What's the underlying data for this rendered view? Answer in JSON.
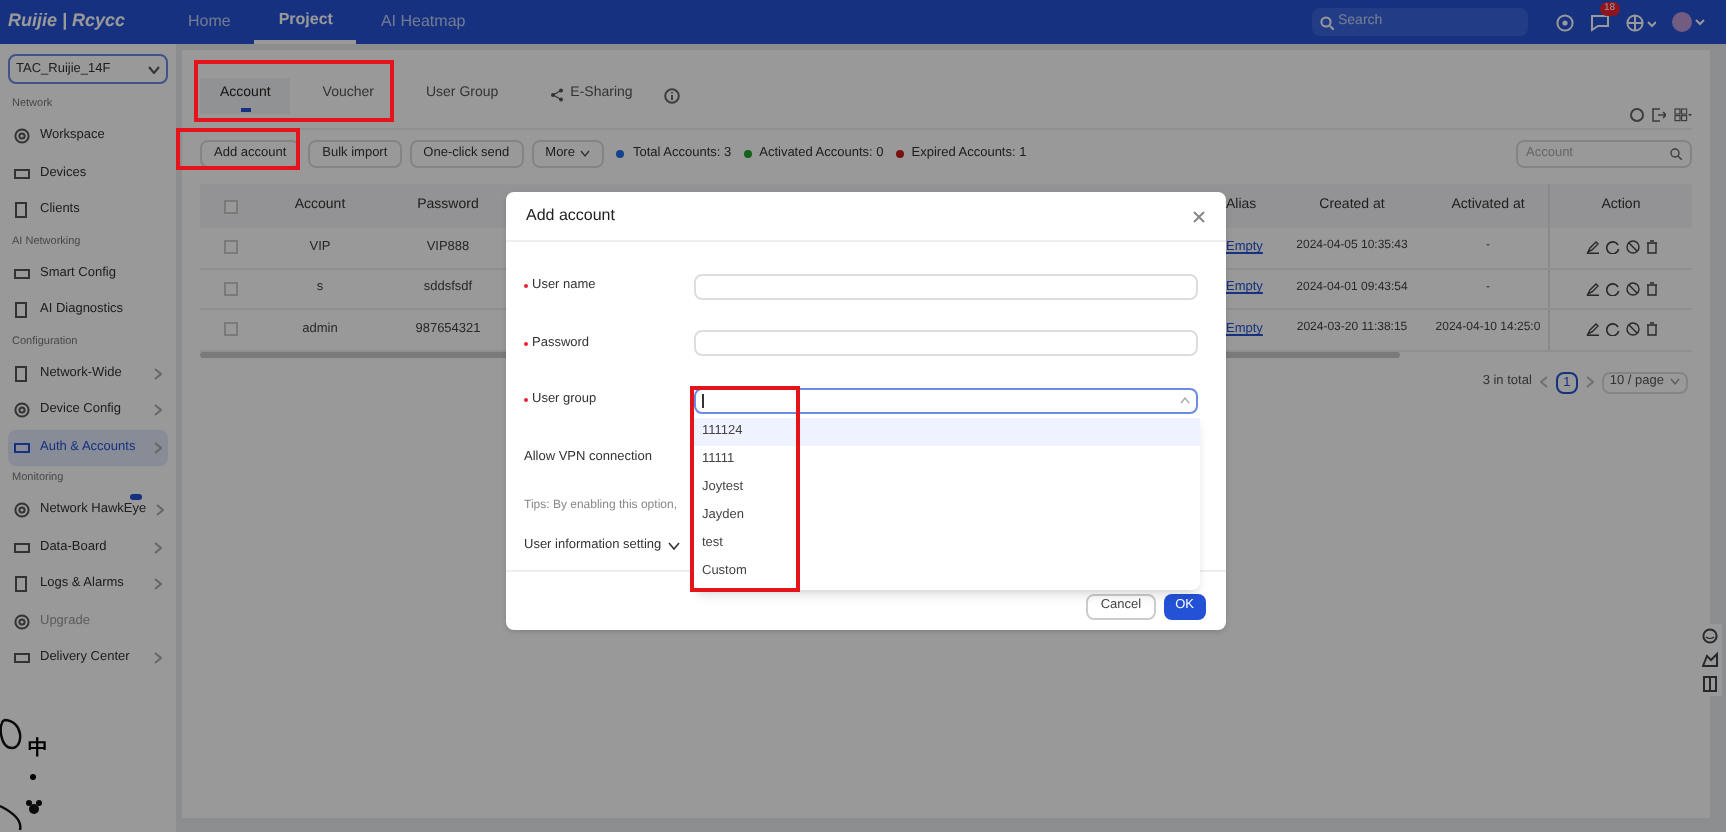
{
  "header": {
    "logo": "Ruijie | Rcycc",
    "nav": [
      {
        "label": "Home",
        "selected": false
      },
      {
        "label": "Project",
        "selected": true
      },
      {
        "label": "AI Heatmap",
        "selected": false
      }
    ],
    "search": {
      "placeholder": "Search"
    },
    "notification_count": "18"
  },
  "sidebar": {
    "project": "TAC_Ruijie_14F",
    "sections": [
      {
        "title": "Network",
        "items": [
          {
            "label": "Workspace",
            "selected": false,
            "submenu": false
          },
          {
            "label": "Devices",
            "selected": false,
            "submenu": false
          },
          {
            "label": "Clients",
            "selected": false,
            "submenu": false
          }
        ]
      },
      {
        "title": "AI Networking",
        "items": [
          {
            "label": "Smart Config",
            "selected": false,
            "submenu": false
          },
          {
            "label": "AI Diagnostics",
            "selected": false,
            "submenu": false
          }
        ]
      },
      {
        "title": "Configuration",
        "items": [
          {
            "label": "Network-Wide",
            "selected": false,
            "submenu": true
          },
          {
            "label": "Device Config",
            "selected": false,
            "submenu": true
          },
          {
            "label": "Auth & Accounts",
            "selected": true,
            "submenu": true
          }
        ]
      },
      {
        "title": "Monitoring",
        "items": [
          {
            "label": "Network HawkEye",
            "selected": false,
            "submenu": true,
            "new": true
          },
          {
            "label": "Data-Board",
            "selected": false,
            "submenu": true
          },
          {
            "label": "Logs & Alarms",
            "selected": false,
            "submenu": true
          },
          {
            "label": "Upgrade",
            "selected": false,
            "submenu": false,
            "disabled": true
          },
          {
            "label": "Delivery Center",
            "selected": false,
            "submenu": true
          }
        ]
      }
    ]
  },
  "ime_toolbar": {
    "mode": "中"
  },
  "tabs": [
    {
      "label": "Account",
      "selected": true
    },
    {
      "label": "Voucher",
      "selected": false
    },
    {
      "label": "User Group",
      "selected": false
    },
    {
      "label": "E-Sharing",
      "selected": false
    }
  ],
  "toolbar": {
    "buttons": [
      {
        "label": "Add account",
        "menu": false
      },
      {
        "label": "Bulk import",
        "menu": false
      },
      {
        "label": "One-click send",
        "menu": false
      },
      {
        "label": "More",
        "menu": true
      }
    ],
    "stats": [
      {
        "text": "Total Accounts: 3",
        "color": "#13438d"
      },
      {
        "text": "Activated Accounts: 0",
        "color": "#14621c"
      },
      {
        "text": "Expired Accounts: 1",
        "color": "#7a1310"
      }
    ],
    "search": {
      "placeholder": "Account"
    }
  },
  "table": {
    "select_all_checked": false,
    "columns": [
      "Account",
      "Password",
      "Alias",
      "Created at",
      "Activated at",
      "Action"
    ],
    "rows": [
      {
        "account": "VIP",
        "password": "VIP888",
        "alias": "Empty",
        "created_at": "2024-04-05 10:35:43",
        "activated_at": "-",
        "checked": false
      },
      {
        "account": "s",
        "password": "sddsfsdf",
        "alias": "Empty",
        "created_at": "2024-04-01 09:43:54",
        "activated_at": "-",
        "checked": false
      },
      {
        "account": "admin",
        "password": "987654321",
        "alias": "Empty",
        "created_at": "2024-03-20 11:38:15",
        "activated_at": "2024-04-10 14:25:0",
        "checked": false
      }
    ]
  },
  "pagination": {
    "total": "3 in total",
    "pages": [
      {
        "label": "1",
        "selected": true
      }
    ],
    "page_size": "10 / page"
  },
  "dialog": {
    "title": "Add account",
    "fields": [
      {
        "label": "User name",
        "required": true,
        "focused": false
      },
      {
        "label": "Password",
        "required": true,
        "focused": false
      },
      {
        "label": "User group",
        "required": true,
        "focused": true
      }
    ],
    "vpn_label": "Allow VPN connection",
    "tips": "Tips: By enabling this option,",
    "user_info": "User information setting",
    "buttons": [
      {
        "label": "Cancel",
        "primary": false
      },
      {
        "label": "OK",
        "primary": true
      }
    ],
    "dropdown": [
      {
        "label": "111124",
        "active": true
      },
      {
        "label": "11111",
        "active": false
      },
      {
        "label": "Joytest",
        "active": false
      },
      {
        "label": "Jayden",
        "active": false
      },
      {
        "label": "test",
        "active": false
      },
      {
        "label": "Custom",
        "active": false
      }
    ]
  }
}
